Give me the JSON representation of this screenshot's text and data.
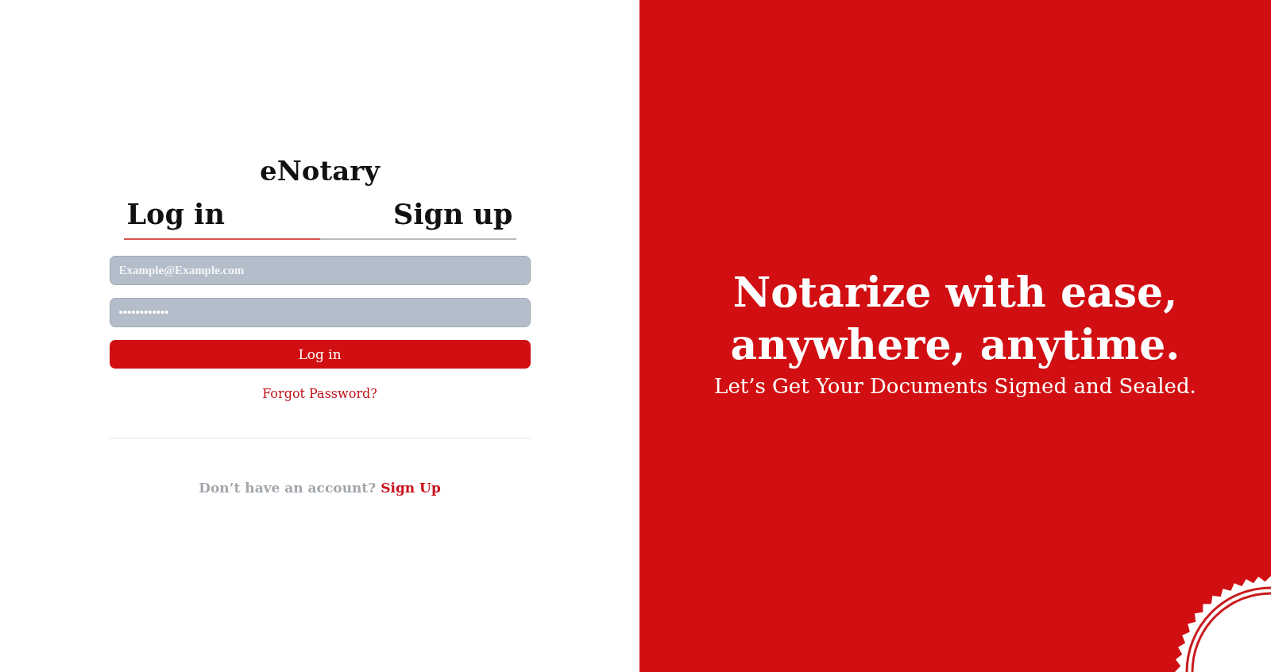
{
  "brand": "eNotary",
  "tabs": [
    {
      "label": "Log in",
      "selected": true
    },
    {
      "label": "Sign up",
      "selected": false
    }
  ],
  "email_field": {
    "placeholder": "Example@Example.com"
  },
  "password_field": {
    "value": "••••••••••••"
  },
  "login_button": "Log in",
  "forgot_link": "Forgot Password?",
  "signup_prompt": {
    "text": "Don’t have an account?",
    "link": "Sign Up"
  },
  "hero": {
    "headline_lines": [
      "Notarize with ease,",
      "anywhere, anytime."
    ],
    "subtitle": "Let’s Get Your Documents Signed and Sealed."
  }
}
